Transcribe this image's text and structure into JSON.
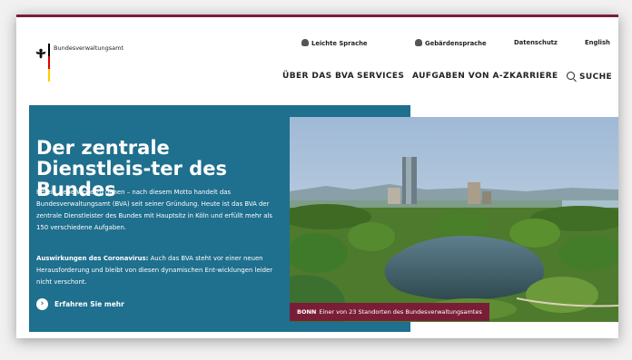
{
  "header": {
    "org_name": "Bundesverwaltungsamt",
    "utility_links": [
      {
        "label": "Leichte Sprache",
        "icon": "easy-language-icon"
      },
      {
        "label": "Gebärdensprache",
        "icon": "sign-language-icon"
      },
      {
        "label": "Datenschutz"
      },
      {
        "label": "English"
      }
    ],
    "nav": [
      {
        "label": "ÜBER DAS BVA"
      },
      {
        "label": "SERVICES"
      },
      {
        "label": "AUFGABEN VON A-Z"
      },
      {
        "label": "KARRIERE"
      },
      {
        "label": "SUCHE",
        "icon": "search-icon"
      }
    ]
  },
  "hero": {
    "title": "Der zentrale Dienstleis-ter des Bundes",
    "intro": "Bereit, neue Wege zu gehen – nach diesem Motto handelt das Bundesverwaltungsamt (BVA) seit seiner Gründung. Heute ist das BVA der zentrale Dienstleister des Bundes mit Hauptsitz in Köln und erfüllt mehr als 150 verschiedene Aufgaben.",
    "corona_label": "Auswirkungen des Coronavirus:",
    "corona_text": "Auch das BVA steht vor einer neuen Herausforderung und bleibt von diesen dynamischen Ent-wicklungen leider nicht verschont.",
    "cta_label": "Erfahren Sie mehr",
    "caption_place": "BONN",
    "caption_text": "Einer von 23 Standorten des Bundesverwaltungsamtes"
  },
  "colors": {
    "accent": "#7a1e37",
    "hero_bg": "#1f6f8e"
  }
}
